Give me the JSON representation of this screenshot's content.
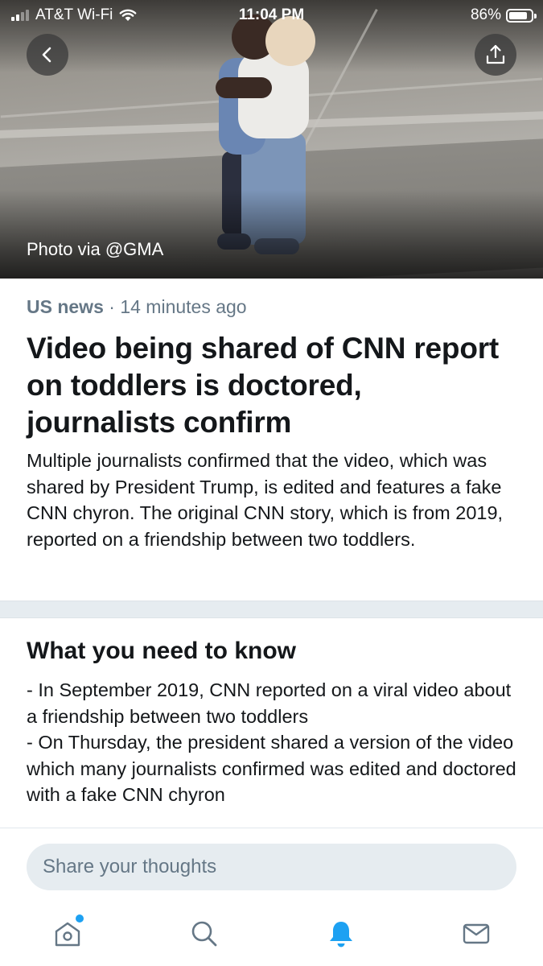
{
  "status_bar": {
    "carrier": "AT&T Wi-Fi",
    "time": "11:04 PM",
    "battery": "86%",
    "battery_level": 0.86
  },
  "hero": {
    "photo_credit": "Photo via @GMA",
    "back_icon": "chevron-left-icon",
    "share_icon": "share-upload-icon"
  },
  "article": {
    "category": "US news",
    "separator": " · ",
    "time_ago": "14 minutes ago",
    "headline": "Video being shared of CNN report on toddlers is doctored, journalists confirm",
    "summary": "Multiple journalists confirmed that the video, which was shared by President Trump, is edited and features a fake CNN chyron. The original CNN story, which is from 2019, reported on a friendship between two toddlers."
  },
  "know": {
    "title": "What you need to know",
    "bullets": [
      "- In September 2019, CNN reported on a viral video about a friendship between two toddlers",
      "- On Thursday, the president shared a version of the video which many journalists confirmed was edited and doctored with a fake CNN chyron"
    ]
  },
  "composer": {
    "placeholder": "Share your thoughts"
  },
  "tabs": [
    {
      "name": "home",
      "icon": "home-icon",
      "active": false,
      "badge": true
    },
    {
      "name": "search",
      "icon": "search-icon",
      "active": false,
      "badge": false
    },
    {
      "name": "notifications",
      "icon": "bell-icon",
      "active": true,
      "badge": false
    },
    {
      "name": "messages",
      "icon": "mail-icon",
      "active": false,
      "badge": false
    }
  ],
  "colors": {
    "accent": "#1da1f2",
    "icon_gray": "#657786",
    "text": "#14171a",
    "divider": "#e6ecf0"
  }
}
